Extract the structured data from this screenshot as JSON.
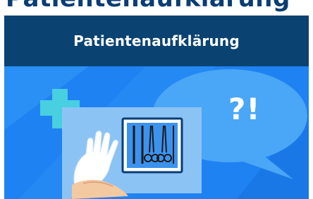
{
  "top_clip_text": "Patientenaufklärung",
  "card": {
    "title": "Patientenaufklärung",
    "bubble_text": "?!"
  },
  "colors": {
    "header_bg": "#0a4372",
    "illustration_bg": "#1f82f2",
    "bubble": "#4aa6f6",
    "plus_cross": "#48cfe0",
    "document": "#8cc3f5"
  },
  "icons": [
    "plus-cross-icon",
    "hand-icon",
    "surgical-tools-icon",
    "speech-bubble-icon"
  ]
}
